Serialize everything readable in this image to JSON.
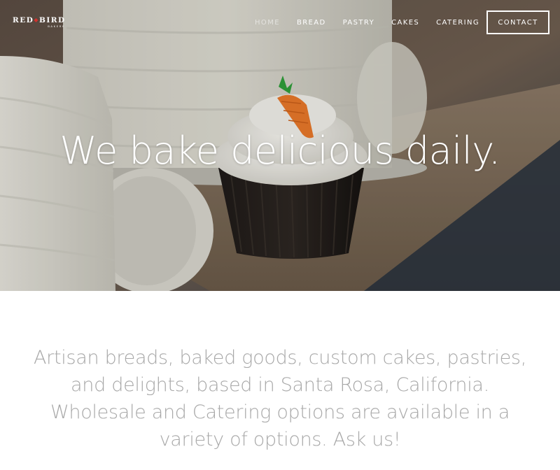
{
  "brand": {
    "logo_red": "RED",
    "logo_bird": "BIRD",
    "logo_sub": "BAKERY"
  },
  "nav": {
    "items": [
      {
        "label": "HOME",
        "active": true
      },
      {
        "label": "BREAD",
        "active": false
      },
      {
        "label": "PASTRY",
        "active": false
      },
      {
        "label": "CAKES",
        "active": false
      },
      {
        "label": "CATERING",
        "active": false
      }
    ],
    "contact_label": "CONTACT"
  },
  "hero": {
    "title": "We bake delicious daily."
  },
  "intro": {
    "text": "Artisan breads, baked goods, custom cakes, pastries, and delights, based in Santa Rosa, California. Wholesale and Catering options are available in a variety of options. Ask us!"
  },
  "colors": {
    "logo_accent": "#d0312d",
    "intro_text": "#a8a8a8",
    "nav_text": "#ffffff"
  },
  "icons": {
    "hero_image": "cupcake-with-carrot-photo"
  }
}
